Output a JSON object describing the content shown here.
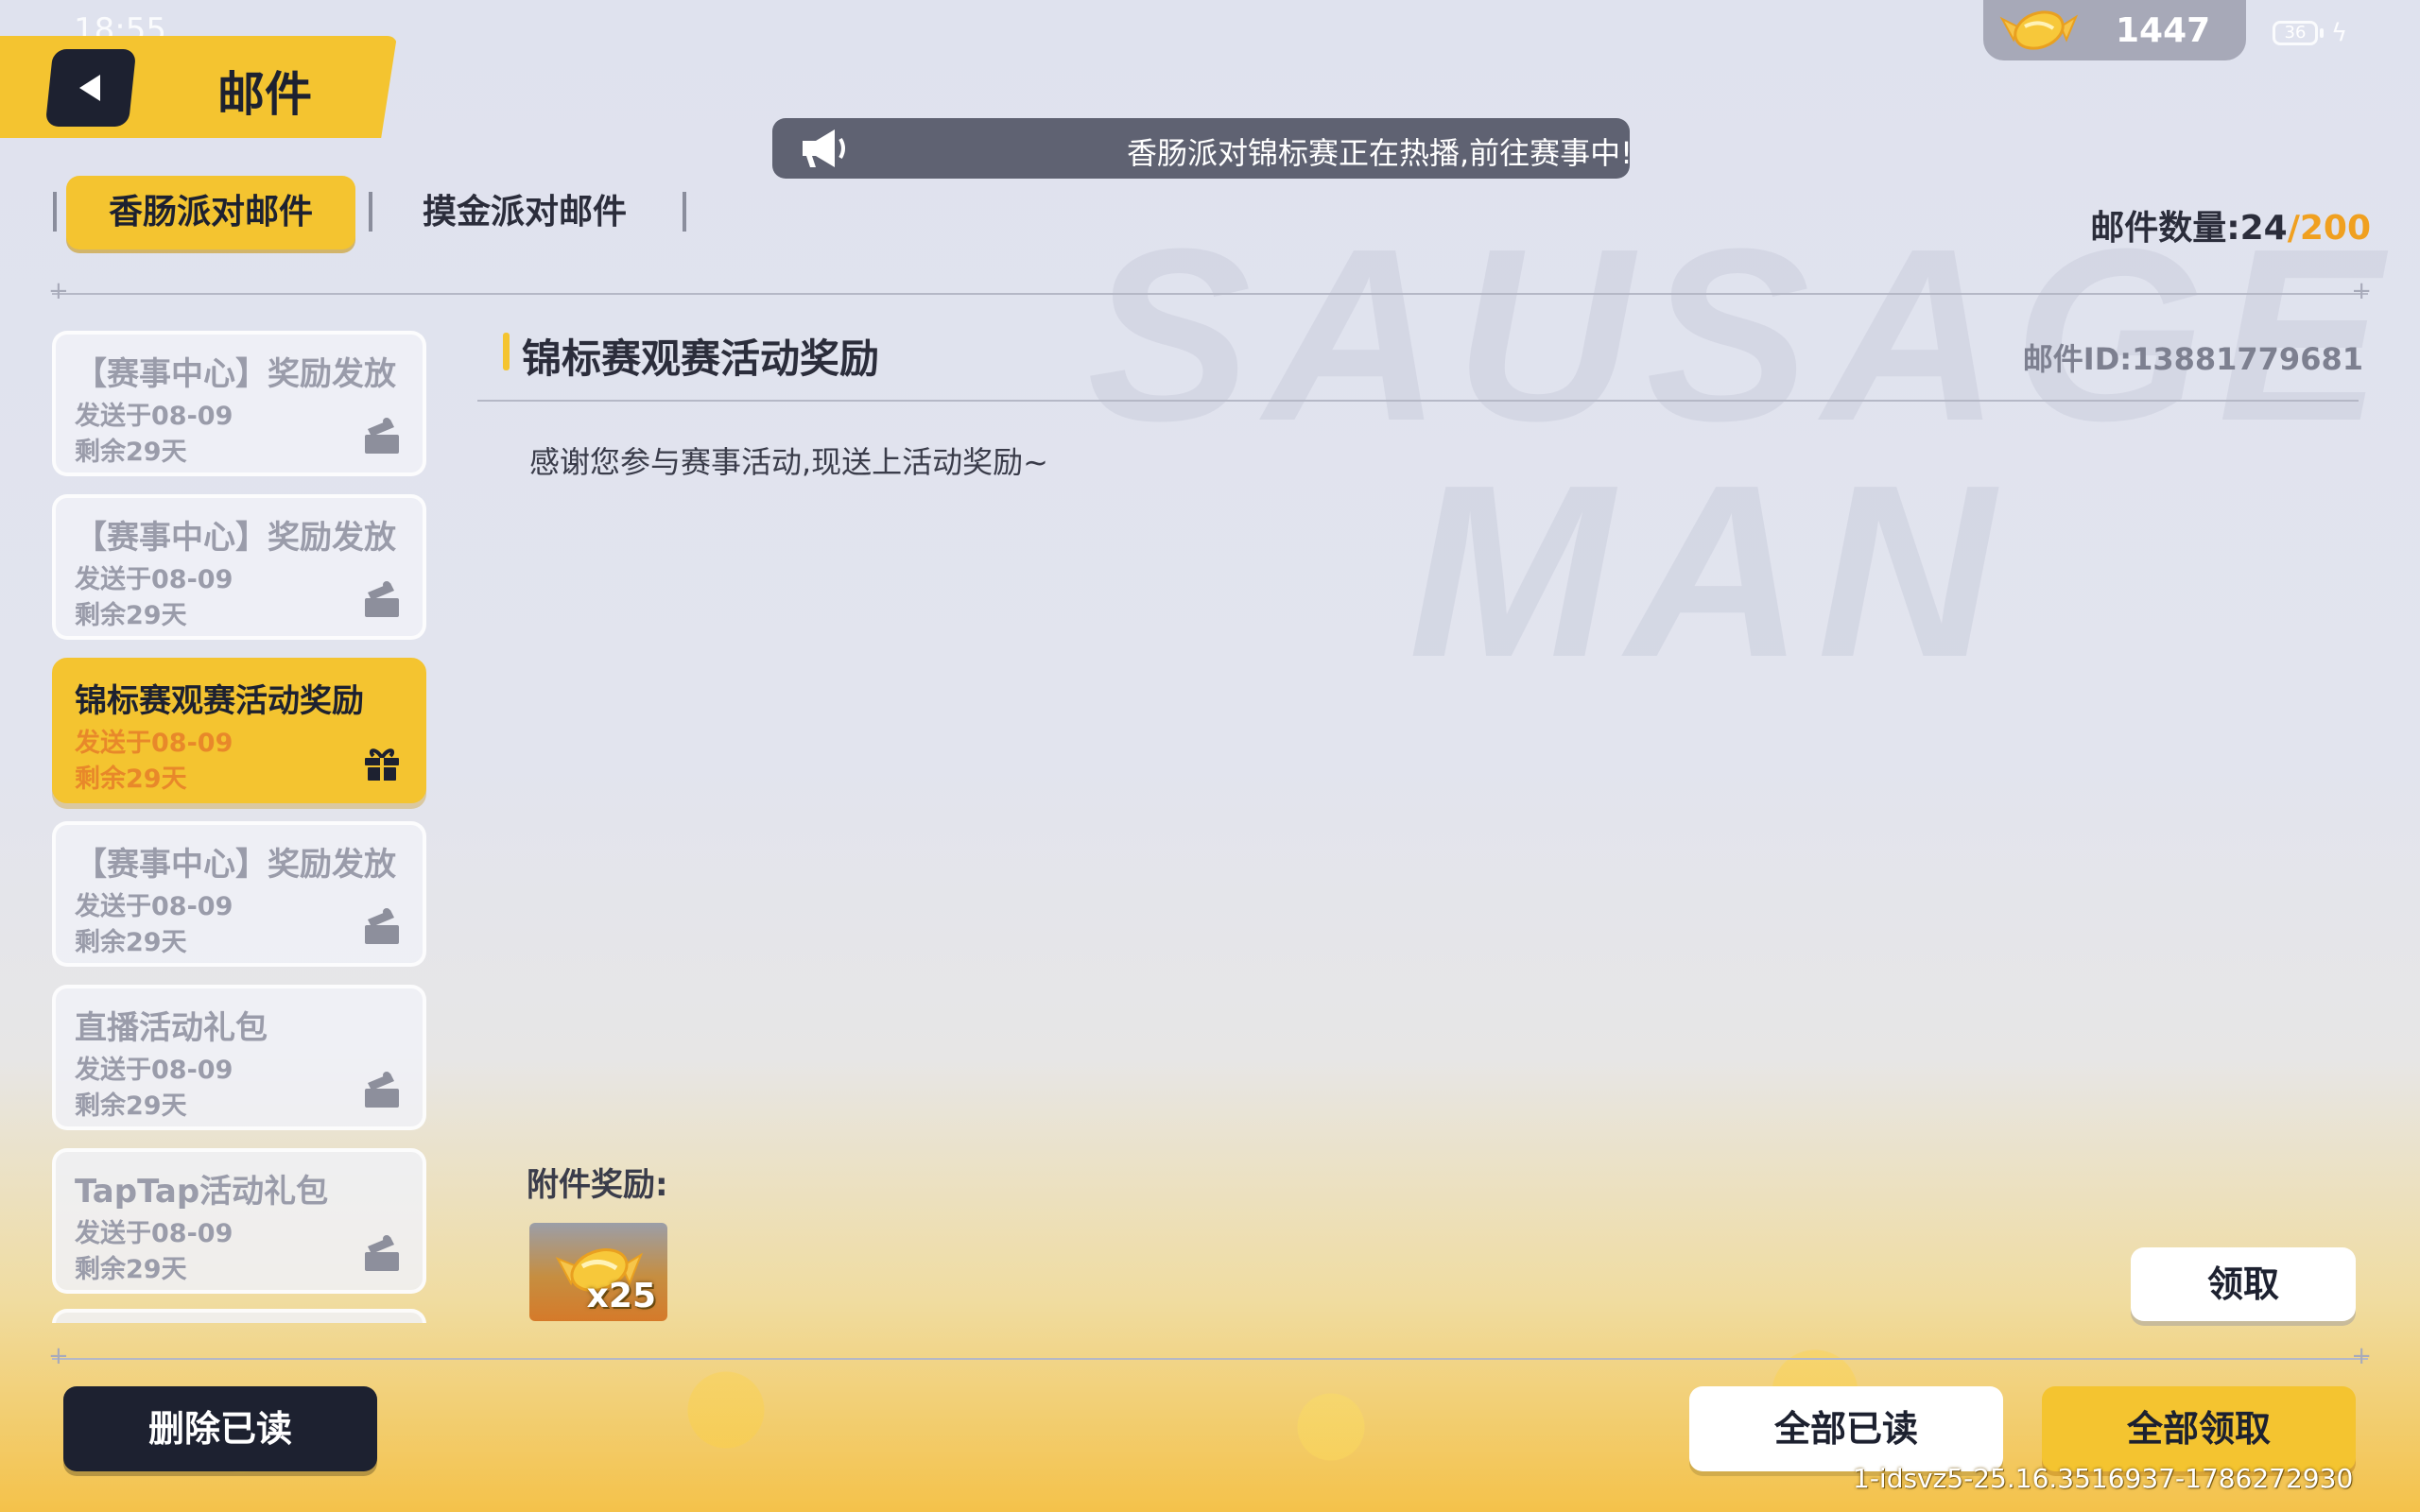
{
  "status_bar": {
    "time": "18:55",
    "battery": "36",
    "currency_amount": "1447",
    "currency_icon": "candy-icon"
  },
  "header": {
    "title": "邮件",
    "back_icon": "back-arrow-icon"
  },
  "announcement": {
    "icon": "megaphone-icon",
    "text": "香肠派对锦标赛正在热播,前往赛事中!"
  },
  "tabs": [
    {
      "label": "香肠派对邮件",
      "active": true
    },
    {
      "label": "摸金派对邮件",
      "active": false
    }
  ],
  "mail_count": {
    "label": "邮件数量:",
    "current": "24",
    "max": "/200"
  },
  "mail_list": [
    {
      "title": "【赛事中心】奖励发放",
      "date": "发送于08-09",
      "remaining": "剩余29天",
      "active": false
    },
    {
      "title": "【赛事中心】奖励发放",
      "date": "发送于08-09",
      "remaining": "剩余29天",
      "active": false
    },
    {
      "title": "锦标赛观赛活动奖励",
      "date": "发送于08-09",
      "remaining": "剩余29天",
      "active": true
    },
    {
      "title": "【赛事中心】奖励发放",
      "date": "发送于08-09",
      "remaining": "剩余29天",
      "active": false
    },
    {
      "title": "直播活动礼包",
      "date": "发送于08-09",
      "remaining": "剩余29天",
      "active": false
    },
    {
      "title": "TapTap活动礼包",
      "date": "发送于08-09",
      "remaining": "剩余29天",
      "active": false
    }
  ],
  "detail": {
    "title": "锦标赛观赛活动奖励",
    "mail_id": "邮件ID:13881779681",
    "body": "感谢您参与赛事活动,现送上活动奖励~",
    "attachment_label": "附件奖励:",
    "attachments": [
      {
        "icon": "candy-icon",
        "quantity": "x25"
      }
    ],
    "claim_label": "领取"
  },
  "footer": {
    "delete_read_label": "删除已读",
    "read_all_label": "全部已读",
    "claim_all_label": "全部领取",
    "build_info": "1-idsvz5-25.16.3516937-1786272930"
  },
  "background_watermark": [
    "SAUSAGE",
    "MAN"
  ],
  "colors": {
    "accent": "#f4c430",
    "dark": "#1d2130",
    "highlight_date": "#e8882a",
    "count_max": "#f0a020"
  }
}
